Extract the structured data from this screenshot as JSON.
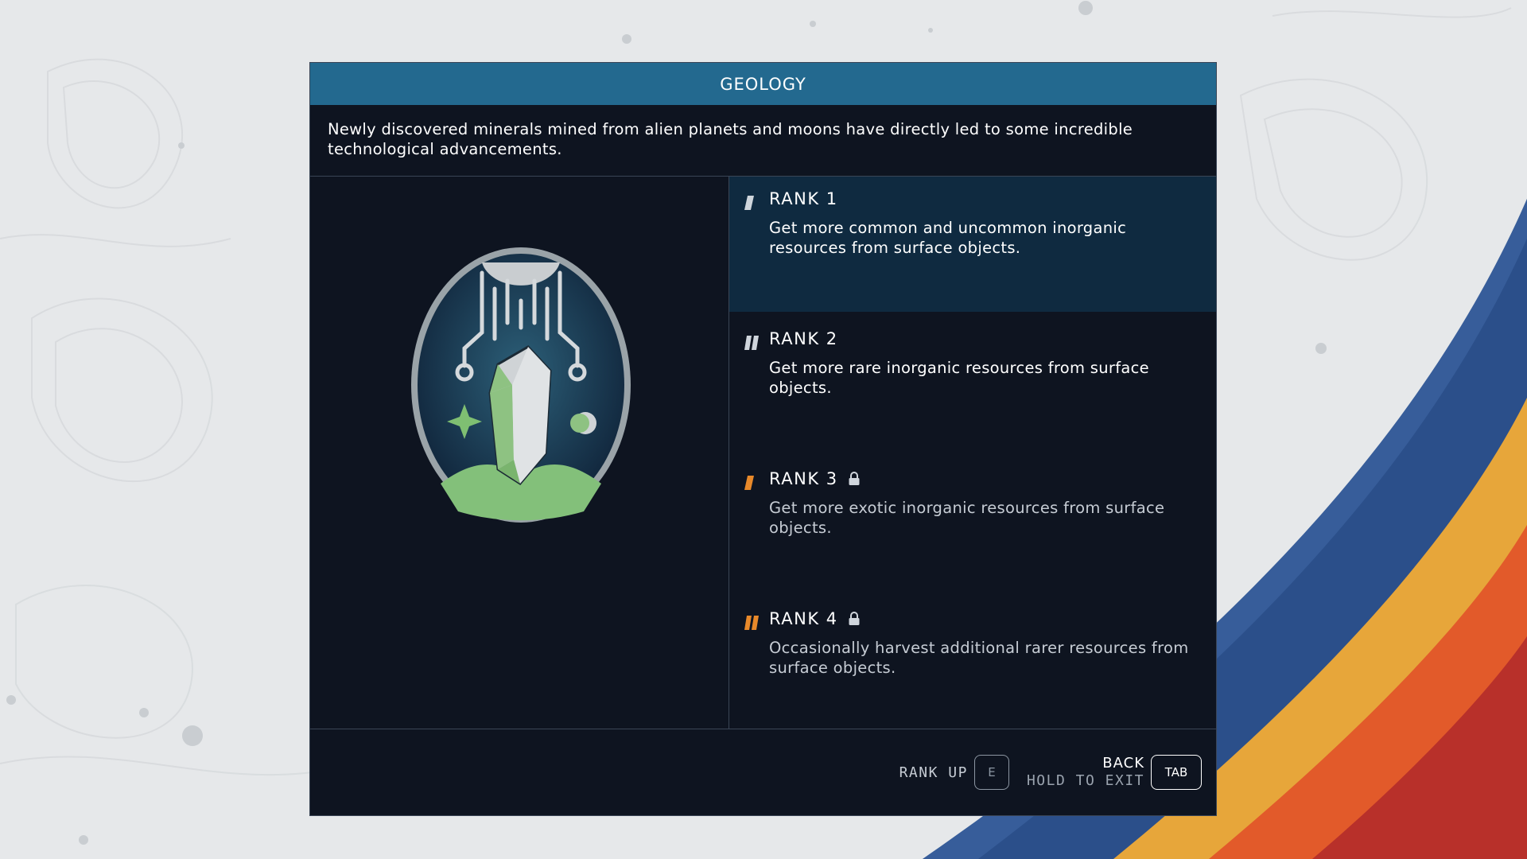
{
  "skill": {
    "title": "GEOLOGY",
    "description": "Newly discovered minerals mined from alien planets and moons have directly led to some incredible technological advancements.",
    "emblem_icon": "geology-crystal-patch-icon"
  },
  "ranks": [
    {
      "label": "RANK 1",
      "description": "Get more common and uncommon inorganic resources from surface objects.",
      "locked": false,
      "selected": true
    },
    {
      "label": "RANK 2",
      "description": "Get more rare inorganic resources from surface objects.",
      "locked": false,
      "selected": false
    },
    {
      "label": "RANK 3",
      "description": "Get more exotic inorganic resources from surface objects.",
      "locked": true,
      "selected": false
    },
    {
      "label": "RANK 4",
      "description": "Occasionally harvest additional rarer resources from surface objects.",
      "locked": true,
      "selected": false
    }
  ],
  "controls": {
    "rank_up_label": "RANK UP",
    "rank_up_key": "E",
    "back_label": "BACK",
    "hold_label": "HOLD TO EXIT",
    "back_key": "TAB"
  },
  "colors": {
    "title_bar": "#23698f",
    "panel": "#0e1420",
    "selected_rank": "#0f2a40",
    "marker_unlocked": "#cfd5dc",
    "marker_locked": "#e8892a"
  }
}
